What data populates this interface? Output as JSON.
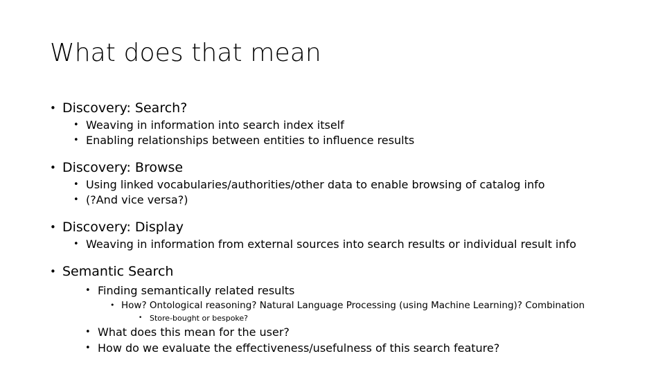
{
  "slide": {
    "title": "What does that mean",
    "bullet_glyph": "•",
    "text_color": "#000000",
    "background_color": "#ffffff",
    "content": [
      {
        "level": 1,
        "text": "Discovery: Search?",
        "children": [
          {
            "level": 2,
            "text": "Weaving in information into search index itself"
          },
          {
            "level": 2,
            "text": "Enabling relationships between entities to influence results"
          }
        ]
      },
      {
        "level": 1,
        "text": "Discovery: Browse",
        "children": [
          {
            "level": 2,
            "text": "Using linked vocabularies/authorities/other data to enable browsing of catalog info"
          },
          {
            "level": 2,
            "text": "(?And vice versa?)"
          }
        ]
      },
      {
        "level": 1,
        "text": "Discovery: Display",
        "children": [
          {
            "level": 2,
            "text": "Weaving in information from external sources into search results or individual result info"
          }
        ]
      },
      {
        "level": 1,
        "text": "Semantic Search",
        "children": [
          {
            "level": 3,
            "text": "Finding semantically related results",
            "children": [
              {
                "level": 4,
                "text": "How? Ontological reasoning? Natural Language Processing (using Machine Learning)? Combination",
                "children": [
                  {
                    "level": 5,
                    "text": "Store-bought or bespoke?"
                  }
                ]
              }
            ]
          },
          {
            "level": 3,
            "text": "What does this mean for the user?"
          },
          {
            "level": 3,
            "text": "How do we evaluate the effectiveness/usefulness of this search feature?"
          }
        ]
      }
    ]
  }
}
